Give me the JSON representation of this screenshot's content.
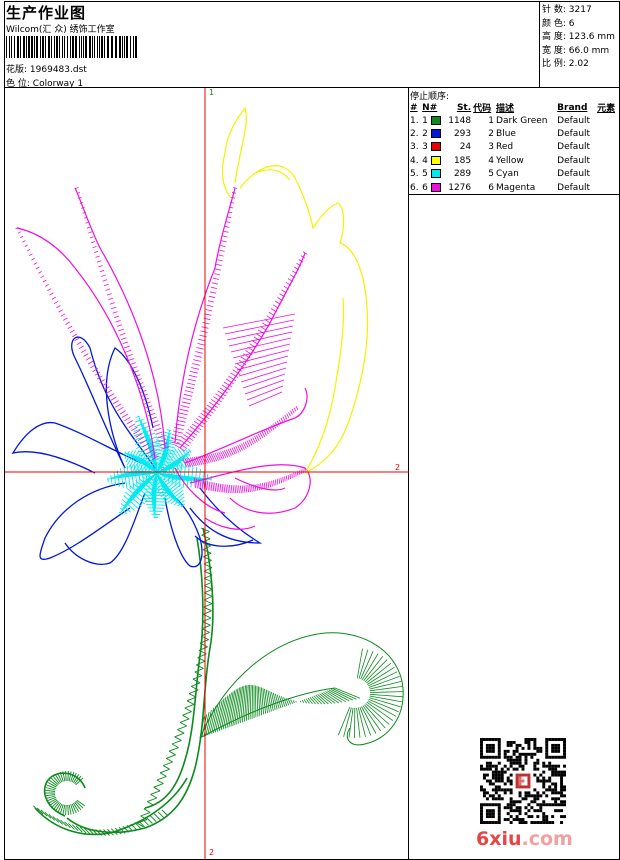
{
  "header": {
    "title": "生产作业图",
    "subtitle": "Wilcom(汇 众) 绣饰工作室",
    "design_label": "花版:",
    "design_value": "1969483.dst",
    "color_label": "色 位:",
    "color_value": "Colorway 1"
  },
  "stats": [
    {
      "label": "针 数:",
      "value": "3217"
    },
    {
      "label": "颜 色:",
      "value": "6"
    },
    {
      "label": "高 度:",
      "value": "123.6 mm"
    },
    {
      "label": "宽 度:",
      "value": "66.0 mm"
    },
    {
      "label": "比 例:",
      "value": "2.02"
    }
  ],
  "stop_sequence": {
    "title": "停止顺序:",
    "columns": [
      "#",
      "N#",
      "St.",
      "代码",
      "描述",
      "Brand",
      "元素"
    ],
    "rows": [
      {
        "seq": "1.",
        "n": "1",
        "color": "#0b8a1e",
        "st": "1148",
        "code": "1",
        "desc": "Dark Green",
        "brand": "Default"
      },
      {
        "seq": "2.",
        "n": "2",
        "color": "#0018d8",
        "st": "293",
        "code": "2",
        "desc": "Blue",
        "brand": "Default"
      },
      {
        "seq": "3.",
        "n": "3",
        "color": "#e80000",
        "st": "24",
        "code": "3",
        "desc": "Red",
        "brand": "Default"
      },
      {
        "seq": "4.",
        "n": "4",
        "color": "#ffff00",
        "st": "185",
        "code": "4",
        "desc": "Yellow",
        "brand": "Default"
      },
      {
        "seq": "5.",
        "n": "5",
        "color": "#00eaf0",
        "st": "289",
        "code": "5",
        "desc": "Cyan",
        "brand": "Default"
      },
      {
        "seq": "6.",
        "n": "6",
        "color": "#ee10e0",
        "st": "1276",
        "code": "6",
        "desc": "Magenta",
        "brand": "Default"
      }
    ]
  },
  "axis_labels": {
    "top": "1",
    "right": "2",
    "bottom": "2"
  },
  "watermark": {
    "main": "6xiu",
    "suffix": ".com"
  },
  "colors": {
    "axis": "#e80000",
    "axis_top_label": "#0b8a1e",
    "axis_right_label": "#e80000",
    "axis_bottom_label": "#e80000",
    "green": "#0b8a1e",
    "blue": "#0018d8",
    "yellow": "#f2f200",
    "cyan": "#00eaf0",
    "magenta": "#ee10e0"
  },
  "icons": {
    "barcode": "barcode-icon",
    "qr": "qr-code-icon"
  }
}
